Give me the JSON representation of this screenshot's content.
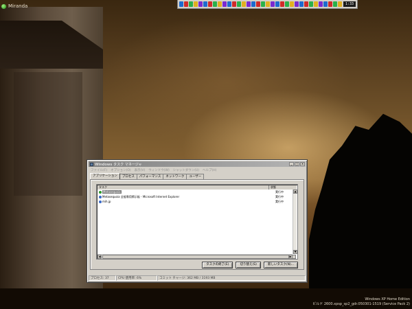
{
  "desktop": {
    "top_left_label": "Miranda",
    "windows_edition": "Windows XP Home Edition",
    "build_info": "ビルド 2600.xpsp_sp2_gdr.050301-1519 (Service Pack 2)"
  },
  "tray": {
    "icon_colors": [
      "#1e6ad0",
      "#d02a2a",
      "#2ab04a",
      "#e0b020",
      "#7a2ad0",
      "#1e6ad0",
      "#d02a2a",
      "#2ab04a",
      "#e0b020",
      "#7a2ad0",
      "#1e6ad0",
      "#d02a2a",
      "#2ab04a",
      "#e0b020",
      "#7a2ad0",
      "#1e6ad0",
      "#d02a2a",
      "#2ab04a",
      "#e0b020",
      "#7a2ad0",
      "#1e6ad0",
      "#d02a2a",
      "#2ab04a",
      "#e0b020",
      "#7a2ad0",
      "#1e6ad0",
      "#d02a2a",
      "#2ab04a",
      "#e0b020",
      "#7a2ad0",
      "#1e6ad0",
      "#d02a2a",
      "#2ab04a",
      "#e0b020"
    ],
    "clock": "1:33"
  },
  "taskmanager": {
    "title": "Windows タスク マネージャ",
    "menu": [
      "ファイル(F)",
      "オプション(O)",
      "表示(V)",
      "ウィンドウ(W)",
      "シャットダウン(U)",
      "ヘルプ(H)"
    ],
    "tabs": [
      "アプリケーション",
      "プロセス",
      "パフォーマンス",
      "ネットワーク",
      "ユーザー"
    ],
    "columns": {
      "task": "タスク",
      "status": "状態"
    },
    "rows": [
      {
        "name": "Metasequoia",
        "status": "実行中",
        "icon": "metasequoia-icon",
        "selected": true
      },
      {
        "name": "Metasequoia 全般専用掲示板 - Microsoft Internet Explorer",
        "status": "実行中",
        "icon": "ie-icon",
        "selected": false
      },
      {
        "name": "mih.jp",
        "status": "実行中",
        "icon": "ie-icon",
        "selected": false
      }
    ],
    "buttons": {
      "end_task": "タスクの終了(E)",
      "switch_to": "切り替え(S)",
      "new_task": "新しいタスク(N)..."
    },
    "status_bar": {
      "processes": "プロセス: 37",
      "cpu": "CPU 使用率: 6%",
      "commit": "コミット チャージ: 362 MB / 3193 MB"
    }
  }
}
